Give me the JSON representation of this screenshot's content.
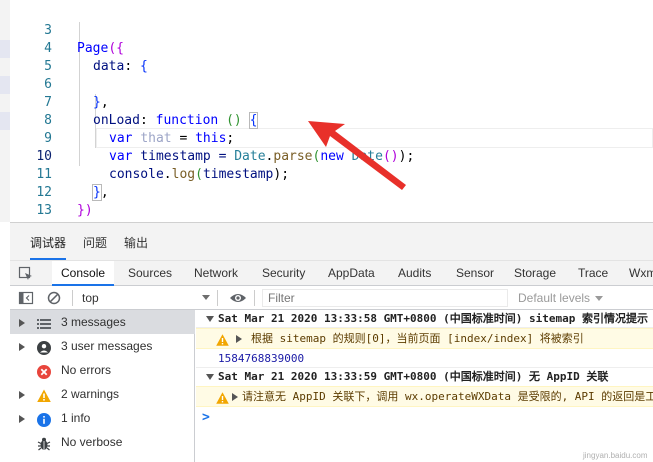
{
  "editor": {
    "lines": [
      {
        "no": "3",
        "html_key": "l3"
      },
      {
        "no": "4",
        "html_key": "l4"
      },
      {
        "no": "5",
        "html_key": "l5"
      },
      {
        "no": "6",
        "html_key": "l6"
      },
      {
        "no": "7",
        "html_key": "l7"
      },
      {
        "no": "8",
        "html_key": "l8"
      },
      {
        "no": "9",
        "html_key": "l9"
      },
      {
        "no": "10",
        "html_key": "l10"
      },
      {
        "no": "11",
        "html_key": "l11"
      },
      {
        "no": "12",
        "html_key": "l12"
      },
      {
        "no": "13",
        "html_key": "l13"
      }
    ],
    "code": {
      "l3_a": "Page",
      "l3_b": "({",
      "l4_a": "data",
      "l4_b": ": ",
      "l4_c": "{",
      "l6_a": "}",
      "l6_b": ",",
      "l7_a": "onLoad",
      "l7_b": ": ",
      "l7_c": "function",
      "l7_d": " ",
      "l7_e": "()",
      "l7_f": " ",
      "l7_g": "{",
      "l8_a": "var",
      "l8_b": " ",
      "l8_c": "that",
      "l8_d": " = ",
      "l8_e": "this",
      "l8_f": ";",
      "l9_a": "var",
      "l9_b": " timestamp = ",
      "l9_c": "Date",
      "l9_d": ".",
      "l9_e": "parse",
      "l9_f": "(",
      "l9_g": "new",
      "l9_h": " ",
      "l9_i": "Date",
      "l9_j": "()",
      "l9_k": ");",
      "l10_a": "console",
      "l10_b": ".",
      "l10_c": "log",
      "l10_d": "(",
      "l10_e": "timestamp",
      "l10_f": ");",
      "l11_a": "}",
      "l11_b": ",",
      "l12_a": "})"
    }
  },
  "panel_tabs": [
    "调试器",
    "问题",
    "输出"
  ],
  "tool_tabs": [
    "Console",
    "Sources",
    "Network",
    "Security",
    "AppData",
    "Audits",
    "Sensor",
    "Storage",
    "Trace",
    "Wxm"
  ],
  "filter_bar": {
    "context": "top",
    "filter_placeholder": "Filter",
    "levels": "Default levels"
  },
  "sidebar": [
    {
      "label": "3 messages",
      "icon": "list-icon"
    },
    {
      "label": "3 user messages",
      "icon": "user-icon"
    },
    {
      "label": "No errors",
      "icon": "error-icon"
    },
    {
      "label": "2 warnings",
      "icon": "warning-icon"
    },
    {
      "label": "1 info",
      "icon": "info-icon"
    },
    {
      "label": "No verbose",
      "icon": "bug-icon"
    }
  ],
  "console": {
    "group1": "Sat Mar 21 2020 13:33:58 GMT+0800 (中国标准时间) sitemap 索引情况提示",
    "warn1": "根据 sitemap 的规则[0]，当前页面 [index/index] 将被索引",
    "log1": "1584768839000",
    "group2": "Sat Mar 21 2020 13:33:59 GMT+0800 (中国标准时间) 无 AppID 关联",
    "warn2": "请注意无 AppID 关联下，调用 wx.operateWXData 是受限的, API 的返回是工具",
    "prompt": ">"
  },
  "watermark": "jingyan.baidu.com",
  "colors": {
    "accent": "#1a73e8",
    "arrow": "#e8302a",
    "warning_bg": "#fffbe5"
  }
}
